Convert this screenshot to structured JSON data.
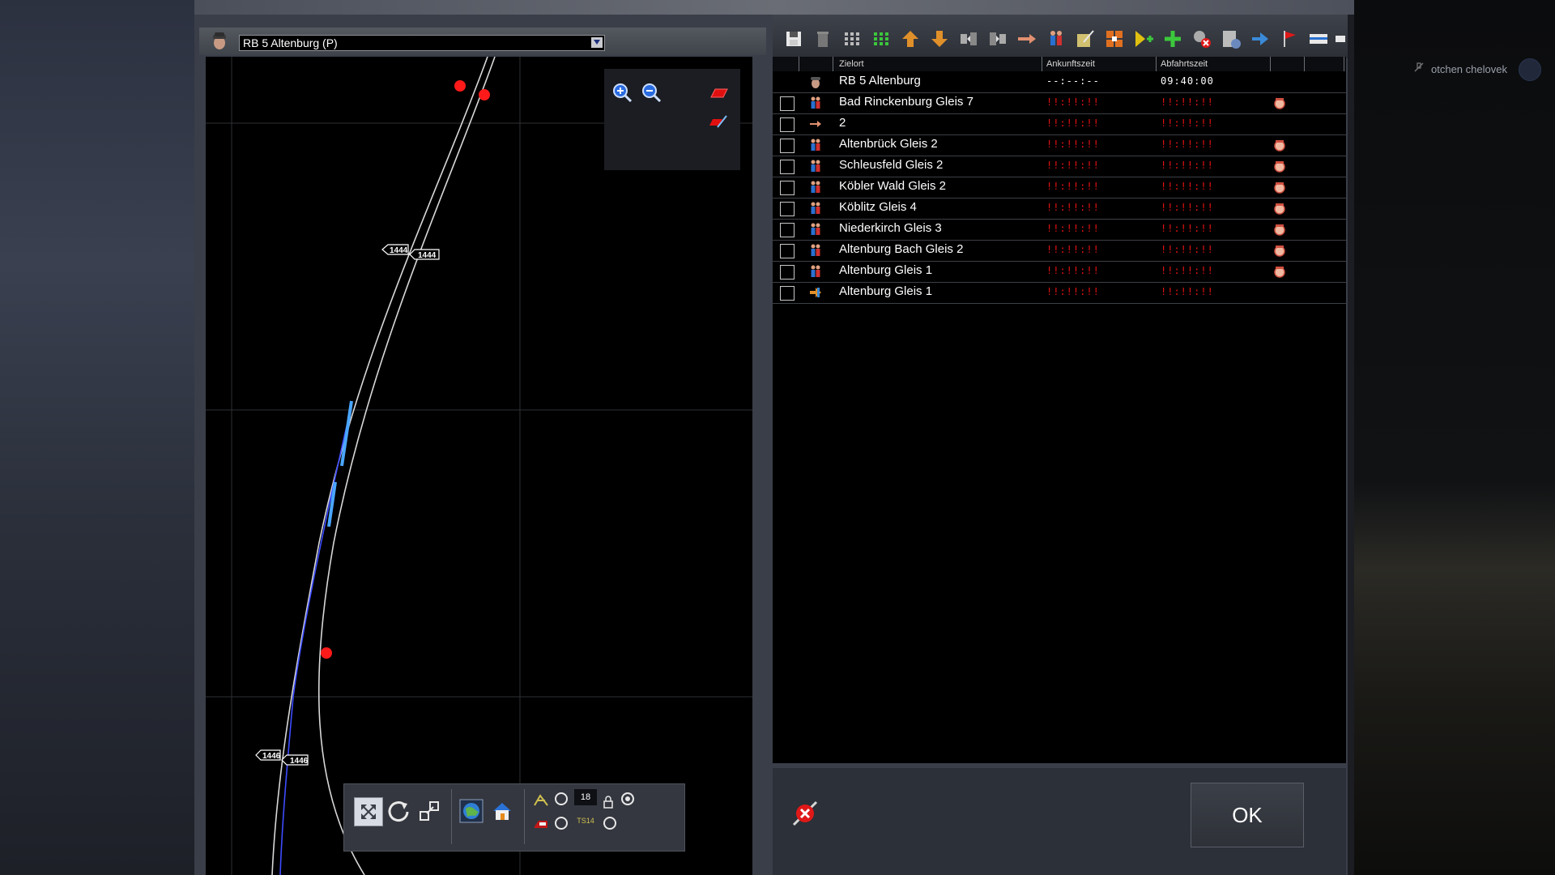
{
  "user": {
    "name": "otchen chelovek"
  },
  "map": {
    "train_selector": "RB 5 Altenburg (P)",
    "signal_labels": [
      "1444",
      "1444",
      "1446",
      "1446"
    ],
    "toolbar": {
      "counter_value": "18",
      "ts_label": "TS14"
    }
  },
  "timetable": {
    "columns": {
      "destination": "Zielort",
      "arrival": "Ankunftszeit",
      "departure": "Abfahrtszeit"
    },
    "header_row": {
      "name": "RB 5 Altenburg",
      "arrival": "--:--:--",
      "departure": "09:40:00"
    },
    "rows": [
      {
        "name": "Bad Rinckenburg Gleis 7",
        "arrival": "!!:!!:!!",
        "departure": "!!:!!:!!",
        "icon": "passengers-icon",
        "end_icon": "driver-face-icon"
      },
      {
        "name": "2",
        "arrival": "!!:!!:!!",
        "departure": "!!:!!:!!",
        "icon": "pointing-hand-icon",
        "end_icon": ""
      },
      {
        "name": "Altenbrück Gleis 2",
        "arrival": "!!:!!:!!",
        "departure": "!!:!!:!!",
        "icon": "passengers-icon",
        "end_icon": "driver-face-icon"
      },
      {
        "name": "Schleusfeld Gleis 2",
        "arrival": "!!:!!:!!",
        "departure": "!!:!!:!!",
        "icon": "passengers-icon",
        "end_icon": "driver-face-icon"
      },
      {
        "name": "Köbler Wald Gleis 2",
        "arrival": "!!:!!:!!",
        "departure": "!!:!!:!!",
        "icon": "passengers-icon",
        "end_icon": "driver-face-icon"
      },
      {
        "name": "Köblitz Gleis 4",
        "arrival": "!!:!!:!!",
        "departure": "!!:!!:!!",
        "icon": "passengers-icon",
        "end_icon": "driver-face-icon"
      },
      {
        "name": "Niederkirch Gleis 3",
        "arrival": "!!:!!:!!",
        "departure": "!!:!!:!!",
        "icon": "passengers-icon",
        "end_icon": "driver-face-icon"
      },
      {
        "name": "Altenburg Bach Gleis 2",
        "arrival": "!!:!!:!!",
        "departure": "!!:!!:!!",
        "icon": "passengers-icon",
        "end_icon": "driver-face-icon"
      },
      {
        "name": "Altenburg Gleis 1",
        "arrival": "!!:!!:!!",
        "departure": "!!:!!:!!",
        "icon": "passengers-icon",
        "end_icon": "driver-face-icon"
      },
      {
        "name": "Altenburg Gleis 1",
        "arrival": "!!:!!:!!",
        "departure": "!!:!!:!!",
        "icon": "exit-arrow-icon",
        "end_icon": ""
      }
    ],
    "ok_label": "OK"
  },
  "colors": {
    "error_red": "#e51212",
    "route_blue": "#3d4cff",
    "marker_red": "#ff1a1a"
  }
}
